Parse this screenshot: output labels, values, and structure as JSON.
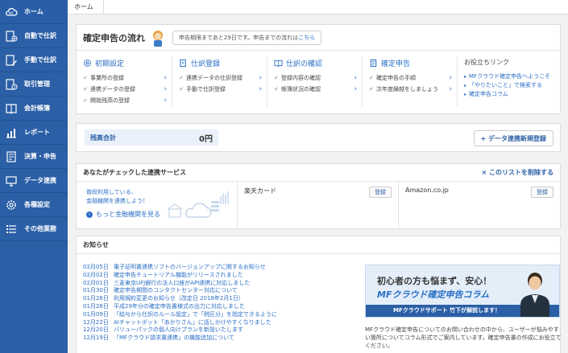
{
  "sidebar": {
    "items": [
      {
        "label": "ホーム",
        "icon": "cloud-logo-icon"
      },
      {
        "label": "自動で仕訳",
        "icon": "auto-journal-icon"
      },
      {
        "label": "手動で仕訳",
        "icon": "manual-journal-icon"
      },
      {
        "label": "取引管理",
        "icon": "transaction-icon"
      },
      {
        "label": "会計帳簿",
        "icon": "ledger-icon"
      },
      {
        "label": "レポート",
        "icon": "report-icon"
      },
      {
        "label": "決算・申告",
        "icon": "settlement-icon"
      },
      {
        "label": "データ連携",
        "icon": "data-link-icon"
      },
      {
        "label": "各種設定",
        "icon": "gear-icon"
      },
      {
        "label": "その他業務",
        "icon": "list-icon"
      }
    ]
  },
  "breadcrumb": {
    "home": "ホーム"
  },
  "flow": {
    "title": "確定申告の流れ",
    "bubble_text": "申告期限まであと29日です。申告までの流れは",
    "bubble_link": "こちら",
    "columns": [
      {
        "title": "初期設定",
        "rows": [
          "事業所の登録",
          "連携データの登録",
          "開始残高の登録"
        ]
      },
      {
        "title": "仕訳登録",
        "rows": [
          "連携データの仕訳登録",
          "手動で仕訳登録"
        ]
      },
      {
        "title": "仕訳の確認",
        "rows": [
          "登録内容の確認",
          "帳簿状況の確認"
        ]
      },
      {
        "title": "確定申告",
        "rows": [
          "確定申告の手順",
          "次年度繰越をしましょう"
        ]
      }
    ],
    "links_title": "お役立ちリンク",
    "links": [
      "MFクラウド確定申告へようこそ",
      "「やりたいこと」で検索する",
      "確定申告コラム"
    ]
  },
  "balance": {
    "label": "残高合計",
    "value": "0円",
    "add_button": "+ データ連携新規登録"
  },
  "services": {
    "title": "あなたがチェックした連携サービス",
    "delete_link": "× このリストを削除する",
    "promo_line1": "普段利用している、",
    "promo_line2": "金融機関を連携しよう！",
    "promo_more": "もっと金融機関を見る",
    "items": [
      {
        "name": "楽天カード",
        "button": "登録"
      },
      {
        "name": "Amazon.co.jp",
        "button": "登録"
      }
    ]
  },
  "news": {
    "title": "お知らせ",
    "items": [
      {
        "date": "02月05日",
        "text": "電子証明書連携ソフトのバージョンアップに関するお知らせ"
      },
      {
        "date": "02月02日",
        "text": "確定申告チュートリアル機能がリリースされました"
      },
      {
        "date": "02月01日",
        "text": "三菱東京UFJ銀行の法人口座がAPI連携に対応しました"
      },
      {
        "date": "01月30日",
        "text": "確定申告期間のコンタクトセンター対応について"
      },
      {
        "date": "01月26日",
        "text": "利用規約変更のお知らせ（改定日 2018年2月1日）"
      },
      {
        "date": "01月26日",
        "text": "平成29年分の確定申告書様式の出力に対応しました"
      },
      {
        "date": "01月09日",
        "text": "「給与から仕訳のルール設定」で「税区分」を指定できるように"
      },
      {
        "date": "12月22日",
        "text": "AIチャットボット「あかりさん」に話しかけやすくなりました"
      },
      {
        "date": "12月20日",
        "text": "バリューパックの個人向けプランを新設いたします"
      },
      {
        "date": "12月19日",
        "text": "「MFクラウド請求書連携」の機能追加について"
      }
    ],
    "banner_title": "初心者の方も悩まず、安心！",
    "banner_subtitle": "MFクラウド確定申告コラム",
    "banner_strip": "MFクラウドサポート 竹下が解説します！",
    "description": "MFクラウド確定申告についてのお問い合わせの中から、ユーザーが悩みやすい箇所についてコラム形式でご案内しています。確定申告書の作成にお役立てください。"
  },
  "colors": {
    "sidebar": "#2b5fa6",
    "accent": "#2b6fc6",
    "background": "#f2f2f2"
  }
}
